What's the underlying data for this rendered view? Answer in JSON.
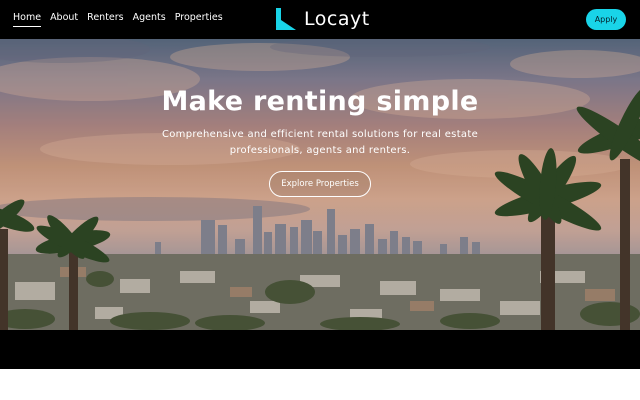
{
  "nav": {
    "links": [
      {
        "label": "Home",
        "active": true
      },
      {
        "label": "About"
      },
      {
        "label": "Renters"
      },
      {
        "label": "Agents"
      },
      {
        "label": "Properties"
      }
    ]
  },
  "brand": {
    "name": "Locayt",
    "logo_icon": "locayt-logo-icon",
    "accent_color": "#19d4e8"
  },
  "header": {
    "apply_label": "Apply"
  },
  "hero": {
    "title": "Make renting simple",
    "subtitle": "Comprehensive and efficient rental solutions for real estate professionals, agents and renters.",
    "cta_label": "Explore Properties",
    "background_image": "city-skyline-with-palm-trees-at-sunset"
  },
  "colors": {
    "nav_background": "#000000",
    "text": "#ffffff"
  }
}
